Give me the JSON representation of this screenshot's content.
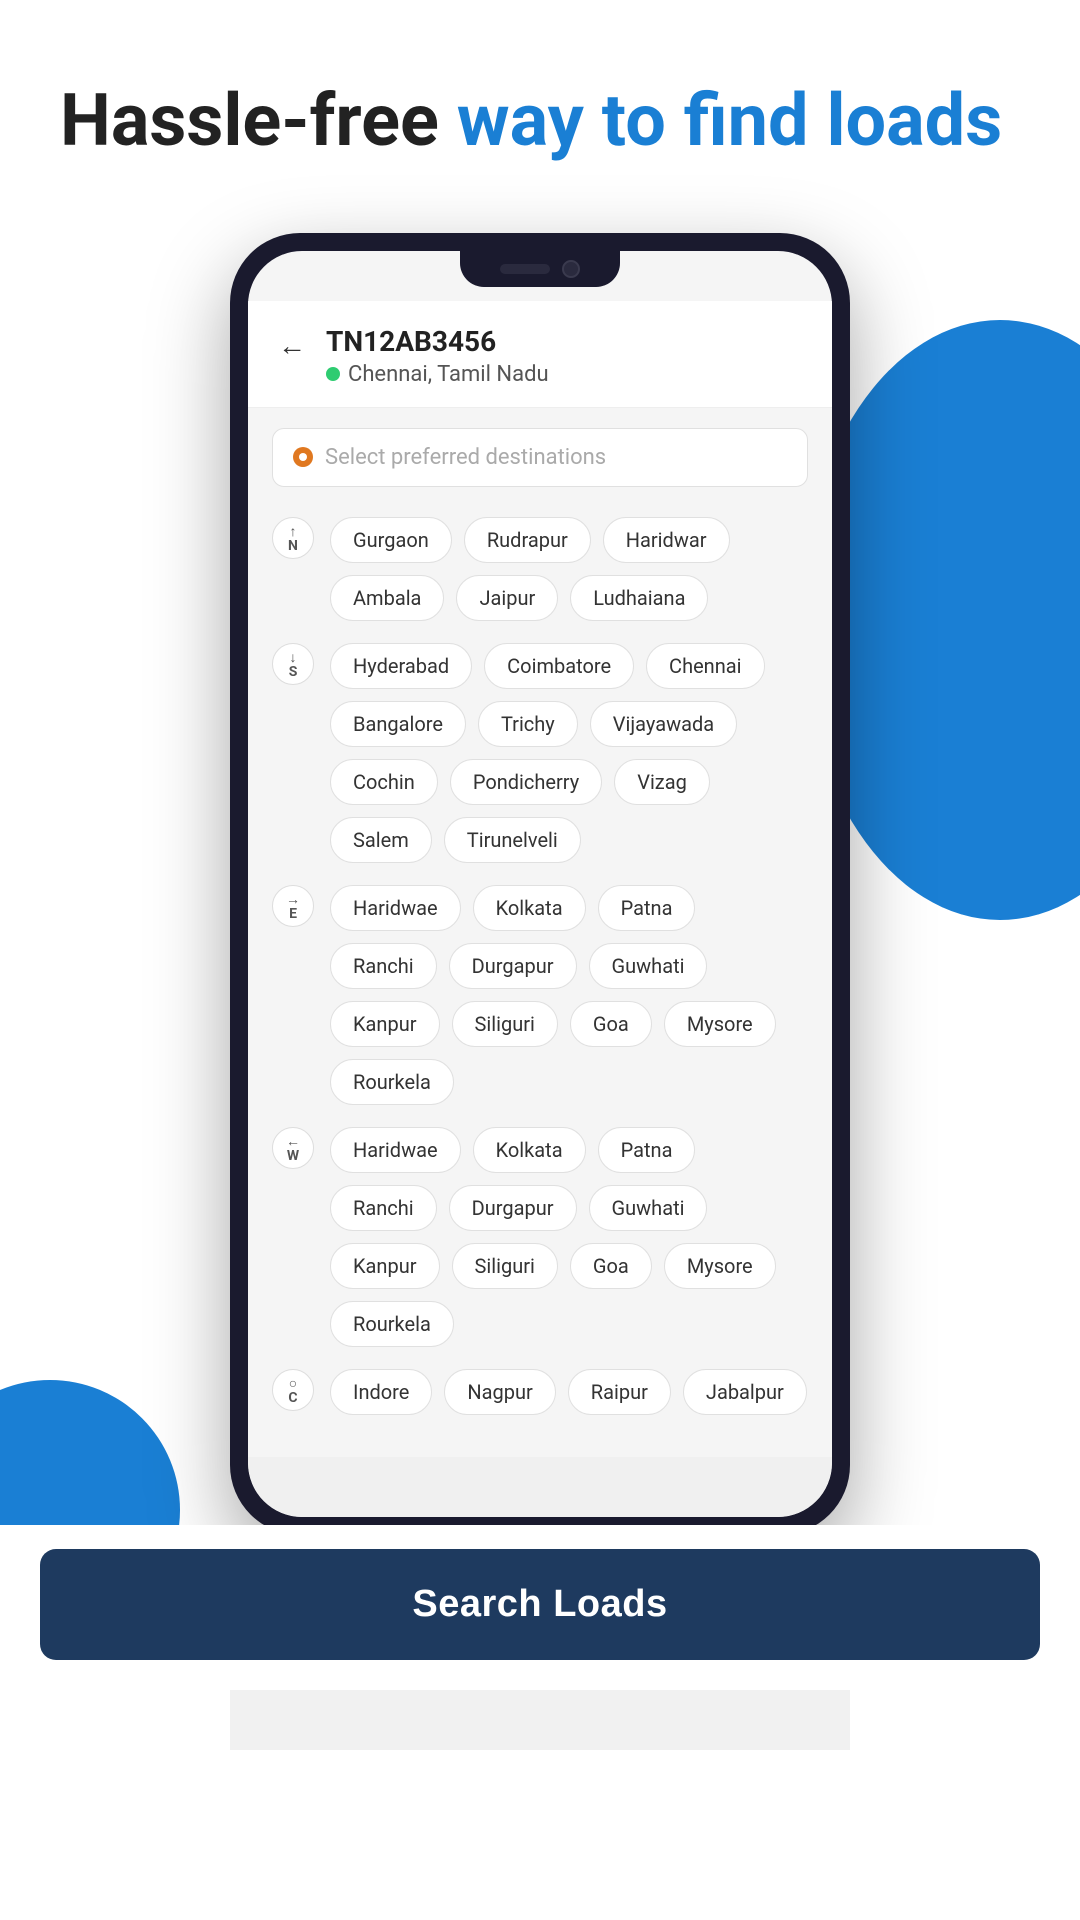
{
  "hero": {
    "title_normal": "Hassle-free ",
    "title_highlight": "way to find loads"
  },
  "phone": {
    "header": {
      "back_label": "←",
      "vehicle_number": "TN12AB3456",
      "location": "Chennai, Tamil Nadu"
    },
    "search_placeholder": "Select preferred destinations",
    "directions": [
      {
        "id": "north",
        "badge": "↑\nN",
        "chips": [
          "Gurgaon",
          "Rudrapur",
          "Haridwar",
          "Ambala",
          "Jaipur",
          "Ludhaiana"
        ]
      },
      {
        "id": "south",
        "badge": "↓\nS",
        "chips": [
          "Hyderabad",
          "Coimbatore",
          "Chennai",
          "Bangalore",
          "Trichy",
          "Vijayawada",
          "Cochin",
          "Pondicherry",
          "Vizag",
          "Salem",
          "Tirunelveli"
        ]
      },
      {
        "id": "east",
        "badge": "→\nE",
        "chips": [
          "Haridwae",
          "Kolkata",
          "Patna",
          "Ranchi",
          "Durgapur",
          "Guwhati",
          "Kanpur",
          "Siliguri",
          "Goa",
          "Mysore",
          "Rourkela"
        ]
      },
      {
        "id": "west",
        "badge": "←\nW",
        "chips": [
          "Haridwae",
          "Kolkata",
          "Patna",
          "Ranchi",
          "Durgapur",
          "Guwhati",
          "Kanpur",
          "Siliguri",
          "Goa",
          "Mysore",
          "Rourkela"
        ]
      },
      {
        "id": "center",
        "badge": "○\nC",
        "chips": [
          "Indore",
          "Nagpur",
          "Raipur",
          "Jabalpur"
        ]
      }
    ],
    "search_button_label": "Search Loads"
  }
}
